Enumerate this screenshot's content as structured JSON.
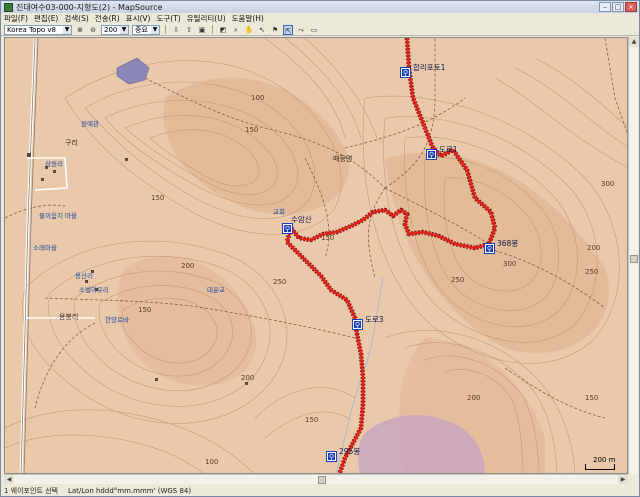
{
  "window": {
    "title": "진대여수03-000-지형도(2) - MapSource",
    "controls": [
      "–",
      "□",
      "×"
    ]
  },
  "menu": [
    "파일(F)",
    "편집(E)",
    "검색(S)",
    "전송(R)",
    "표시(V)",
    "도구(T)",
    "유틸리티(U)",
    "도움말(H)"
  ],
  "toolbar": {
    "map_product": "Korea Topo v8",
    "zoom_value": "200 m",
    "detail_value": "중요",
    "tools": [
      "zoom-in-icon",
      "zoom-out-icon",
      "hand-icon",
      "selection-icon",
      "waypoint-icon",
      "route-icon",
      "track-icon",
      "measure-icon",
      "route-tool-icon"
    ]
  },
  "map": {
    "waypoints": [
      {
        "label": "합리포토1",
        "icon": "hiker-icon"
      },
      {
        "label": "도로1",
        "icon": "hiker-icon"
      },
      {
        "label": "368봉",
        "icon": "hiker-icon"
      },
      {
        "label": "수암산",
        "icon": "hiker-icon"
      },
      {
        "label": "도로3",
        "icon": "hiker-icon"
      },
      {
        "label": "295봉",
        "icon": "hiker-icon"
      }
    ],
    "contour_labels": [
      "100",
      "150",
      "150",
      "200",
      "150",
      "200",
      "250",
      "300",
      "250",
      "250",
      "300",
      "200",
      "150",
      "100",
      "200",
      "150",
      "150"
    ],
    "place_labels": [
      "매등면",
      "구리",
      "용봉리"
    ],
    "poi_labels": [
      "원예관",
      "물끼움지 마을",
      "소래마을",
      "소벌이유리",
      "교회",
      "대운교",
      "삼원리",
      "용산리",
      "한양로바"
    ],
    "scale": "200 m"
  },
  "status": {
    "selection": "1 웨이포인트 선택",
    "position": "Lat/Lon hddd°mm.mmm' (WGS 84)"
  },
  "colors": {
    "terrain": "#e9c9a9",
    "contour": "#c49a72",
    "track": "#d6201a",
    "waypoint": "#1d3fb6"
  }
}
